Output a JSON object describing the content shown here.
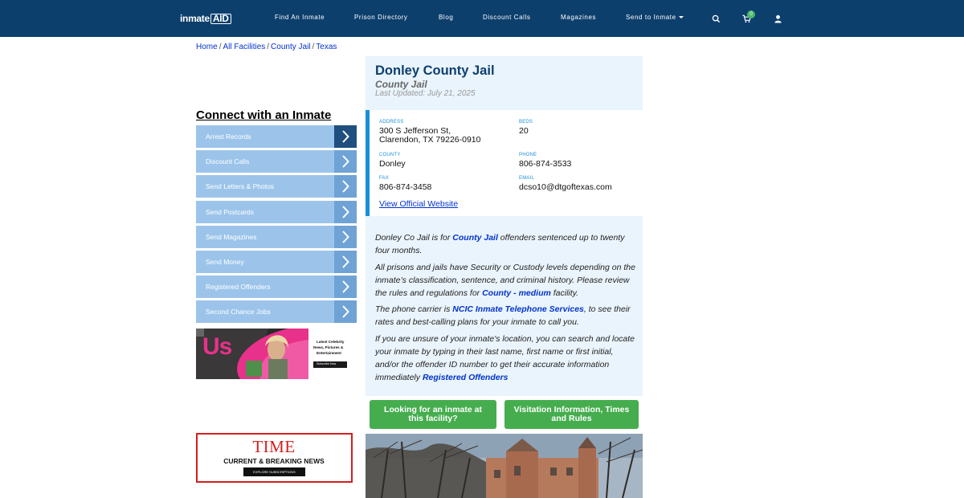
{
  "nav": {
    "logo_main": "inmate",
    "logo_box": "AID",
    "links": [
      "Find An Inmate",
      "Prison Directory",
      "Blog",
      "Discount Calls",
      "Magazines",
      "Send to Inmate"
    ],
    "cart_count": "0",
    "icons": [
      "search-icon",
      "cart-icon",
      "user-icon"
    ]
  },
  "breadcrumb": {
    "items": [
      "Home",
      "All Facilities",
      "County Jail",
      "Texas"
    ],
    "separator": "/"
  },
  "sidebar": {
    "title": "Connect with an Inmate",
    "items": [
      "Arrest Records",
      "Discount Calls",
      "Send Letters & Photos",
      "Send Postcards",
      "Send Magazines",
      "Send Money",
      "Registered Offenders",
      "Second Chance Jobs"
    ]
  },
  "ads": {
    "us": {
      "logo": "Us",
      "tagline_1": "Latest Celebrity",
      "tagline_2": "News, Pictures &",
      "tagline_3": "Entertainment",
      "cta": "Subscribe Now"
    },
    "time": {
      "logo": "TIME",
      "headline": "CURRENT & BREAKING NEWS",
      "cta": "EXPLORE SUBSCRIPTIONS"
    }
  },
  "facility": {
    "name": "Donley County Jail",
    "type": "County Jail",
    "updated": "Last Updated: July 21, 2025",
    "address_label": "ADDRESS",
    "address_line1": "300 S Jefferson St,",
    "address_line2": "Clarendon, TX 79226-0910",
    "beds_label": "BEDS",
    "beds": "20",
    "county_label": "COUNTY",
    "county": "Donley",
    "phone_label": "PHONE",
    "phone": "806-874-3533",
    "fax_label": "FAX",
    "fax": "806-874-3458",
    "email_label": "EMAIL",
    "email": "dcso10@dtgoftexas.com",
    "website_link": "View Official Website"
  },
  "description": {
    "p1_a": "Donley Co Jail is for ",
    "p1_link": "County Jail",
    "p1_b": " offenders sentenced up to twenty four months.",
    "p2_a": "All prisons and jails have Security or Custody levels depending on the inmate’s classification, sentence, and criminal history. Please review the rules and regulations for ",
    "p2_link": "County - medium",
    "p2_b": " facility.",
    "p3_a": "The phone carrier is ",
    "p3_link": "NCIC Inmate Telephone Services",
    "p3_b": ", to see their rates and best-calling plans for your inmate to call you.",
    "p4_a": "If you are unsure of your inmate's location, you can search and locate your inmate by typing in their last name, first name or first initial, and/or the offender ID number to get their accurate information immediately ",
    "p4_link": "Registered Offenders"
  },
  "buttons": {
    "looking": "Looking for an inmate at this facility?",
    "visitation": "Visitation Information, Times and Rules"
  },
  "colors": {
    "navbar": "#0d3f6d",
    "menu_item": "#9cc4ea",
    "menu_arrow": "#6fa3d6",
    "menu_arrow_active": "#1f4f7f",
    "card_bg": "#eaf4fc",
    "accent_blue": "#1a8fd6",
    "green_button": "#45ad4e",
    "link": "#0033cc"
  }
}
